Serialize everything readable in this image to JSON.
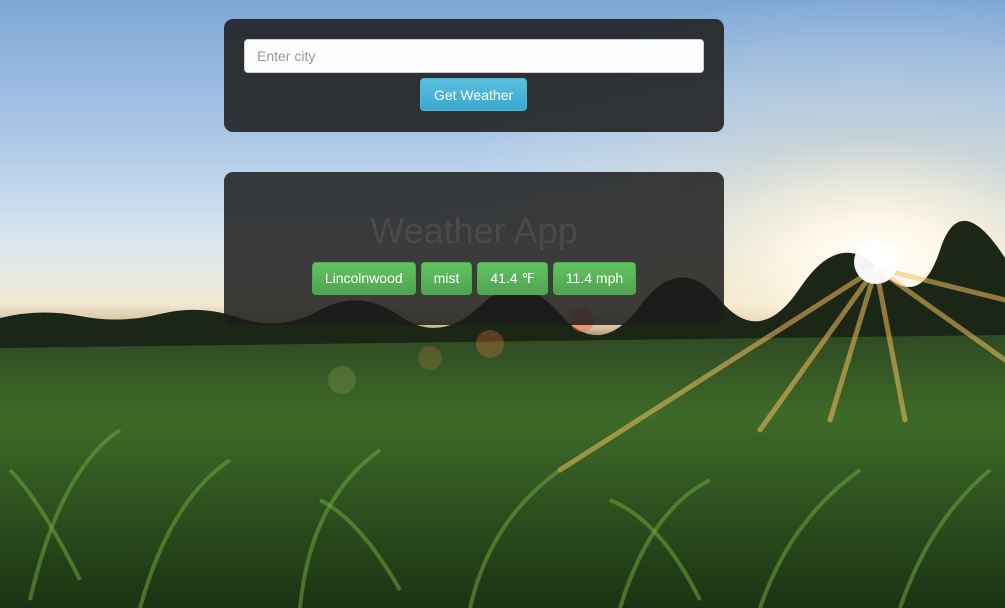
{
  "search": {
    "placeholder": "Enter city",
    "value": "",
    "button_label": "Get Weather"
  },
  "result": {
    "title": "Weather App",
    "city": "Lincolnwood",
    "condition": "mist",
    "temperature": "41.4 ℉",
    "wind_speed": "11.4 mph"
  },
  "colors": {
    "button_accent": "#5bc0de",
    "badge_accent": "#5cb85c",
    "panel_bg": "#1e1e1e"
  },
  "background": {
    "scene": "cornfield-sunset-icon"
  }
}
